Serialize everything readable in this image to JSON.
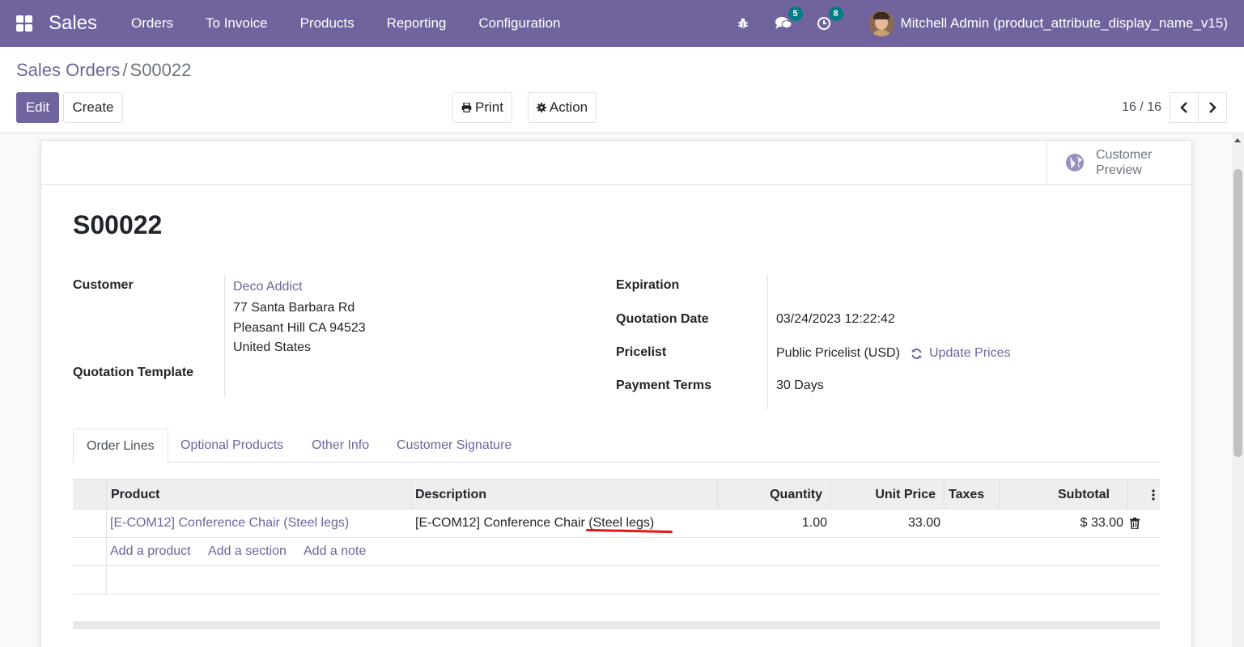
{
  "navbar": {
    "brand": "Sales",
    "menu": [
      "Orders",
      "To Invoice",
      "Products",
      "Reporting",
      "Configuration"
    ],
    "messages_count": "5",
    "activities_count": "8",
    "user": "Mitchell Admin (product_attribute_display_name_v15)",
    "color": "#71639e"
  },
  "breadcrumb": {
    "parent": "Sales Orders",
    "separator": "/",
    "current": "S00022"
  },
  "toolbar": {
    "edit_label": "Edit",
    "create_label": "Create",
    "print_label": "Print",
    "action_label": "Action"
  },
  "pager": {
    "value": "16 / 16"
  },
  "stat_button": {
    "line1": "Customer",
    "line2": "Preview"
  },
  "order": {
    "name": "S00022",
    "customer_label": "Customer",
    "customer_name": "Deco Addict",
    "address_line1": "77 Santa Barbara Rd",
    "address_line2": "Pleasant Hill CA 94523",
    "address_line3": "United States",
    "template_label": "Quotation Template",
    "expiration_label": "Expiration",
    "quotation_date_label": "Quotation Date",
    "quotation_date": "03/24/2023 12:22:42",
    "pricelist_label": "Pricelist",
    "pricelist": "Public Pricelist (USD)",
    "update_prices": "Update Prices",
    "payment_terms_label": "Payment Terms",
    "payment_terms": "30 Days"
  },
  "tabs": [
    "Order Lines",
    "Optional Products",
    "Other Info",
    "Customer Signature"
  ],
  "table": {
    "headers": {
      "product": "Product",
      "description": "Description",
      "quantity": "Quantity",
      "unit_price": "Unit Price",
      "taxes": "Taxes",
      "subtotal": "Subtotal"
    },
    "rows": [
      {
        "product": "[E-COM12] Conference Chair (Steel legs)",
        "description": "[E-COM12] Conference Chair (Steel legs)",
        "quantity": "1.00",
        "unit_price": "33.00",
        "taxes": "",
        "subtotal": "$ 33.00"
      }
    ],
    "add_product": "Add a product",
    "add_section": "Add a section",
    "add_note": "Add a note"
  },
  "annotation_color": "#e8141a"
}
